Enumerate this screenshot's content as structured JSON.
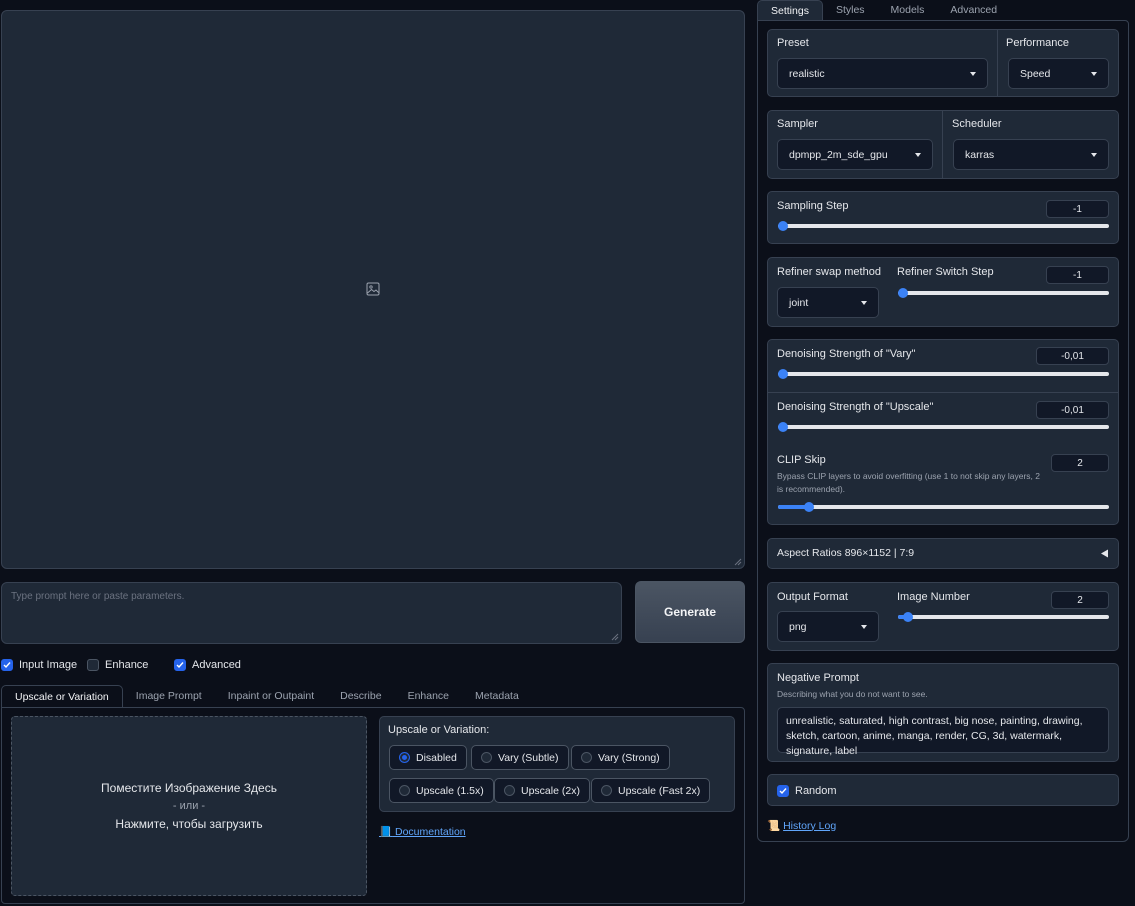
{
  "prompt": {
    "placeholder": "Type prompt here or paste parameters."
  },
  "generate_label": "Generate",
  "checks": {
    "input_image": "Input Image",
    "enhance": "Enhance",
    "advanced": "Advanced"
  },
  "left_tabs": [
    "Upscale or Variation",
    "Image Prompt",
    "Inpaint or Outpaint",
    "Describe",
    "Enhance",
    "Metadata"
  ],
  "drop_zone": {
    "line1": "Поместите Изображение Здесь",
    "line2": "- или -",
    "line3": "Нажмите, чтобы загрузить"
  },
  "uov": {
    "title": "Upscale or Variation:",
    "options": [
      "Disabled",
      "Vary (Subtle)",
      "Vary (Strong)",
      "Upscale (1.5x)",
      "Upscale (2x)",
      "Upscale (Fast 2x)"
    ],
    "selected": "Disabled"
  },
  "documentation_link": "Documentation",
  "right_tabs": [
    "Settings",
    "Styles",
    "Models",
    "Advanced"
  ],
  "settings": {
    "preset": {
      "label": "Preset",
      "value": "realistic"
    },
    "performance": {
      "label": "Performance",
      "value": "Speed"
    },
    "sampler": {
      "label": "Sampler",
      "value": "dpmpp_2m_sde_gpu"
    },
    "scheduler": {
      "label": "Scheduler",
      "value": "karras"
    },
    "sampling_step": {
      "label": "Sampling Step",
      "value": "-1"
    },
    "refiner_swap": {
      "label": "Refiner swap method",
      "value": "joint"
    },
    "refiner_switch": {
      "label": "Refiner Switch Step",
      "value": "-1"
    },
    "denoise_vary": {
      "label": "Denoising Strength of \"Vary\"",
      "value": "-0,01"
    },
    "denoise_upscale": {
      "label": "Denoising Strength of \"Upscale\"",
      "value": "-0,01"
    },
    "clip_skip": {
      "label": "CLIP Skip",
      "desc": "Bypass CLIP layers to avoid overfitting (use 1 to not skip any layers, 2 is recommended).",
      "value": "2",
      "level": 0.08
    },
    "aspect_ratios": {
      "label": "Aspect Ratios 896×1152 | 7:9"
    },
    "output_format": {
      "label": "Output Format",
      "value": "png"
    },
    "image_number": {
      "label": "Image Number",
      "value": "2"
    },
    "negative_prompt": {
      "label": "Negative Prompt",
      "desc": "Describing what you do not want to see.",
      "value": "unrealistic, saturated, high contrast, big nose, painting, drawing, sketch, cartoon, anime, manga, render, CG, 3d, watermark, signature, label"
    },
    "random": {
      "label": "Random"
    },
    "history_log": "History Log"
  },
  "colors": {
    "accent": "#3b82f6",
    "background": "#0b0f19",
    "panel": "#1f2937"
  }
}
